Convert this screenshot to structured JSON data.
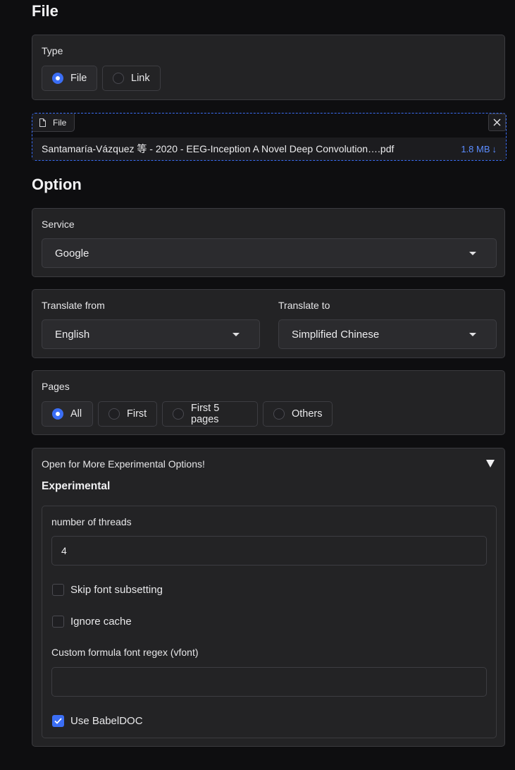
{
  "file_section": {
    "title": "File",
    "type_label": "Type",
    "type_options": [
      {
        "label": "File",
        "selected": true
      },
      {
        "label": "Link",
        "selected": false
      }
    ]
  },
  "upload": {
    "tag": "File",
    "filename": "Santamaría-Vázquez 等 - 2020 - EEG-Inception A Novel Deep Convolution….pdf",
    "size": "1.8 MB",
    "download_icon": "download-arrow-icon",
    "close_icon": "close-icon"
  },
  "option_section": {
    "title": "Option",
    "service_label": "Service",
    "service_value": "Google",
    "translate_from_label": "Translate from",
    "translate_from_value": "English",
    "translate_to_label": "Translate to",
    "translate_to_value": "Simplified Chinese",
    "pages_label": "Pages",
    "pages_options": [
      {
        "label": "All",
        "selected": true
      },
      {
        "label": "First",
        "selected": false
      },
      {
        "label": "First 5 pages",
        "selected": false
      },
      {
        "label": "Others",
        "selected": false
      }
    ]
  },
  "experimental": {
    "accordion_label": "Open for More Experimental Options!",
    "heading": "Experimental",
    "threads_label": "number of threads",
    "threads_value": "4",
    "skip_font_label": "Skip font subsetting",
    "skip_font_checked": false,
    "ignore_cache_label": "Ignore cache",
    "ignore_cache_checked": false,
    "vfont_label": "Custom formula font regex (vfont)",
    "vfont_value": "",
    "babeldoc_label": "Use BabelDOC",
    "babeldoc_checked": true
  },
  "colors": {
    "accent": "#3b6ef5",
    "link": "#5b8cff",
    "background": "#0e0e10",
    "panel": "#232325"
  }
}
